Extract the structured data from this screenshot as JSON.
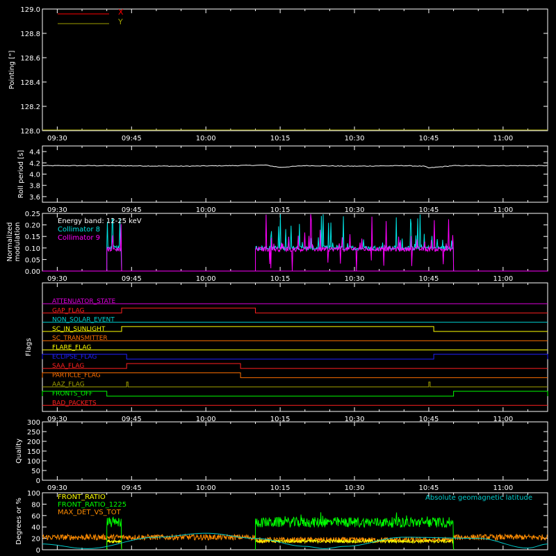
{
  "colors": {
    "background": "#000000",
    "axis": "#ffffff",
    "x_line": "#ff0000",
    "y_line": "#a0a000",
    "roll": "#ffffff",
    "coll8": "#00e5e5",
    "coll9": "#ff00ff",
    "front_ratio": "#ffff00",
    "front_ratio_1225": "#00ff00",
    "max_det_vs_tot": "#ff8c00",
    "geomag": "#00cccc"
  },
  "time_axis": {
    "xlim": [
      "09:27",
      "11:09"
    ],
    "ticks": [
      "09:30",
      "09:45",
      "10:00",
      "10:15",
      "10:30",
      "10:45",
      "11:00"
    ]
  },
  "chart_data": [
    {
      "type": "line",
      "ylabel": "Pointing [\"]",
      "ylim": [
        128.0,
        129.0
      ],
      "yticks": [
        "128.0",
        "128.2",
        "128.4",
        "128.6",
        "128.8",
        "129.0"
      ],
      "legend": {
        "placement": "top-left",
        "entries": [
          "X",
          "Y"
        ]
      },
      "series": [
        {
          "name": "X",
          "x": [],
          "values": []
        },
        {
          "name": "Y",
          "x": [],
          "values": []
        }
      ]
    },
    {
      "type": "line",
      "ylabel": "Roll period [s]",
      "ylim": [
        3.5,
        4.5
      ],
      "yticks": [
        "3.6",
        "3.8",
        "4.0",
        "4.2",
        "4.4"
      ],
      "series": [
        {
          "x": [
            "09:27",
            "09:40",
            "09:55",
            "10:05",
            "10:12",
            "10:15",
            "10:20",
            "10:30",
            "10:40",
            "10:44",
            "10:45",
            "10:50",
            "11:09"
          ],
          "values": [
            4.15,
            4.15,
            4.14,
            4.15,
            4.16,
            4.12,
            4.15,
            4.14,
            4.15,
            4.14,
            4.11,
            4.15,
            4.15
          ]
        }
      ]
    },
    {
      "type": "line",
      "ylabel": "Normalized\nmodulation",
      "ylim": [
        0,
        0.25
      ],
      "yticks": [
        "0.00",
        "0.05",
        "0.10",
        "0.15",
        "0.20",
        "0.25"
      ],
      "annotation": "Energy band: 12-25 keV",
      "legend": {
        "placement": "top-left",
        "entries": [
          "Collimator 8",
          "Collimator 9"
        ]
      },
      "series": [
        {
          "name": "Collimator 8",
          "segments": [
            [
              "09:40",
              "09:43"
            ],
            [
              "10:10",
              "10:50"
            ]
          ],
          "base": 0.1,
          "peak": 0.25
        },
        {
          "name": "Collimator 9",
          "segments": [
            [
              "09:40",
              "09:43"
            ],
            [
              "10:10",
              "10:50"
            ]
          ],
          "base": 0.095,
          "peak": 0.25
        }
      ]
    },
    {
      "type": "line",
      "ylabel": "Flags",
      "flags": [
        {
          "name": "ATTENUATOR_STATE",
          "color": "#dd00dd",
          "states": []
        },
        {
          "name": "GAP_FLAG",
          "color": "#ff2020",
          "states": [
            [
              "09:43",
              "10:10"
            ]
          ]
        },
        {
          "name": "NON_SOLAR_EVENT",
          "color": "#00d0d0",
          "states": []
        },
        {
          "name": "SC_IN_SUNLIGHT",
          "color": "#ffff00",
          "states": [
            [
              "09:43",
              "10:46"
            ]
          ]
        },
        {
          "name": "SC_TRANSMITTER",
          "color": "#ff7000",
          "states": []
        },
        {
          "name": "FLARE_FLAG",
          "color": "#ffff00",
          "states": []
        },
        {
          "name": "ECLIPSE_FLAG",
          "color": "#2020ff",
          "states": [
            [
              "09:27",
              "09:44"
            ],
            [
              "10:46",
              "11:09"
            ]
          ]
        },
        {
          "name": "SAA_FLAG",
          "color": "#ff2020",
          "states": [
            [
              "09:44",
              "10:07"
            ]
          ]
        },
        {
          "name": "PARTICLE_FLAG",
          "color": "#ff7000",
          "states": [
            [
              "09:27",
              "10:07"
            ]
          ]
        },
        {
          "name": "AAZ_FLAG",
          "color": "#a0a000",
          "states": [
            [
              "09:44",
              "09:44"
            ],
            [
              "10:45",
              "10:45"
            ]
          ]
        },
        {
          "name": "FRONTS_OFF",
          "color": "#00ff00",
          "states": [
            [
              "09:27",
              "09:40"
            ],
            [
              "10:50",
              "11:09"
            ]
          ]
        },
        {
          "name": "BAD_PACKETS",
          "color": "#ff2020",
          "states": []
        }
      ]
    },
    {
      "type": "line",
      "ylabel": "Quality",
      "ylim": [
        0,
        300
      ],
      "yticks": [
        "0",
        "50",
        "100",
        "150",
        "200",
        "250",
        "300"
      ],
      "series": []
    },
    {
      "type": "line",
      "ylabel": "Degrees or %",
      "ylim": [
        0,
        100
      ],
      "yticks": [
        "0",
        "20",
        "40",
        "60",
        "80",
        "100"
      ],
      "legend": {
        "placement": "top-left",
        "entries": [
          "FRONT_RATIO",
          "FRONT_RATIO_1225",
          "MAX_DET_VS_TOT"
        ]
      },
      "annotation": "Absolute geomagnetic latitude",
      "series": [
        {
          "name": "FRONT_RATIO",
          "segments": [
            [
              "09:40",
              "09:43"
            ],
            [
              "10:10",
              "10:50"
            ]
          ],
          "base": 15
        },
        {
          "name": "FRONT_RATIO_1225",
          "segments": [
            [
              "09:40",
              "09:43"
            ],
            [
              "10:10",
              "10:50"
            ]
          ],
          "base": 48
        },
        {
          "name": "MAX_DET_VS_TOT",
          "x_range": [
            "09:27",
            "11:09"
          ],
          "base": 22
        },
        {
          "name": "Absolute geomagnetic latitude",
          "x": [
            "09:27",
            "09:36",
            "09:50",
            "10:00",
            "10:10",
            "10:20",
            "10:24",
            "10:28",
            "10:40",
            "10:55",
            "11:05",
            "11:09"
          ],
          "values": [
            10,
            2,
            22,
            29,
            20,
            6,
            2,
            6,
            22,
            20,
            3,
            10
          ]
        }
      ]
    }
  ]
}
